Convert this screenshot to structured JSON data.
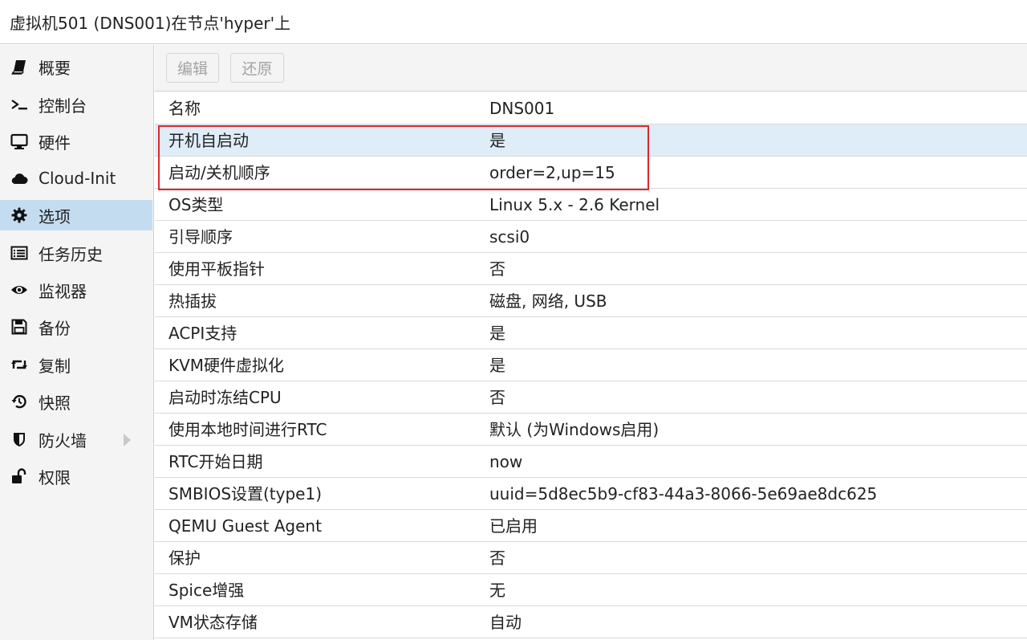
{
  "window": {
    "title": "虚拟机501 (DNS001)在节点'hyper'上"
  },
  "sidebar": {
    "items": [
      {
        "label": "概要",
        "icon": "book-icon"
      },
      {
        "label": "控制台",
        "icon": "terminal-icon"
      },
      {
        "label": "硬件",
        "icon": "monitor-icon"
      },
      {
        "label": "Cloud-Init",
        "icon": "cloud-icon"
      },
      {
        "label": "选项",
        "icon": "gear-icon",
        "active": true
      },
      {
        "label": "任务历史",
        "icon": "list-icon"
      },
      {
        "label": "监视器",
        "icon": "eye-icon"
      },
      {
        "label": "备份",
        "icon": "floppy-icon"
      },
      {
        "label": "复制",
        "icon": "retweet-icon"
      },
      {
        "label": "快照",
        "icon": "history-icon"
      },
      {
        "label": "防火墙",
        "icon": "shield-icon",
        "expandable": true
      },
      {
        "label": "权限",
        "icon": "unlock-icon"
      }
    ]
  },
  "toolbar": {
    "edit_label": "编辑",
    "revert_label": "还原"
  },
  "options": {
    "rows": [
      {
        "name": "名称",
        "value": "DNS001"
      },
      {
        "name": "开机自启动",
        "value": "是",
        "selected": true
      },
      {
        "name": "启动/关机顺序",
        "value": "order=2,up=15"
      },
      {
        "name": "OS类型",
        "value": "Linux 5.x - 2.6 Kernel"
      },
      {
        "name": "引导顺序",
        "value": "scsi0"
      },
      {
        "name": "使用平板指针",
        "value": "否"
      },
      {
        "name": "热插拔",
        "value": "磁盘, 网络, USB"
      },
      {
        "name": "ACPI支持",
        "value": "是"
      },
      {
        "name": "KVM硬件虚拟化",
        "value": "是"
      },
      {
        "name": "启动时冻结CPU",
        "value": "否"
      },
      {
        "name": "使用本地时间进行RTC",
        "value": "默认 (为Windows启用)"
      },
      {
        "name": "RTC开始日期",
        "value": "now"
      },
      {
        "name": "SMBIOS设置(type1)",
        "value": "uuid=5d8ec5b9-cf83-44a3-8066-5e69ae8dc625"
      },
      {
        "name": "QEMU Guest Agent",
        "value": "已启用"
      },
      {
        "name": "保护",
        "value": "否"
      },
      {
        "name": "Spice增强",
        "value": "无"
      },
      {
        "name": "VM状态存储",
        "value": "自动"
      }
    ]
  },
  "colors": {
    "selected_row": "#dfedf8",
    "active_nav": "#c4dcf0",
    "highlight_border": "#e0262c"
  }
}
